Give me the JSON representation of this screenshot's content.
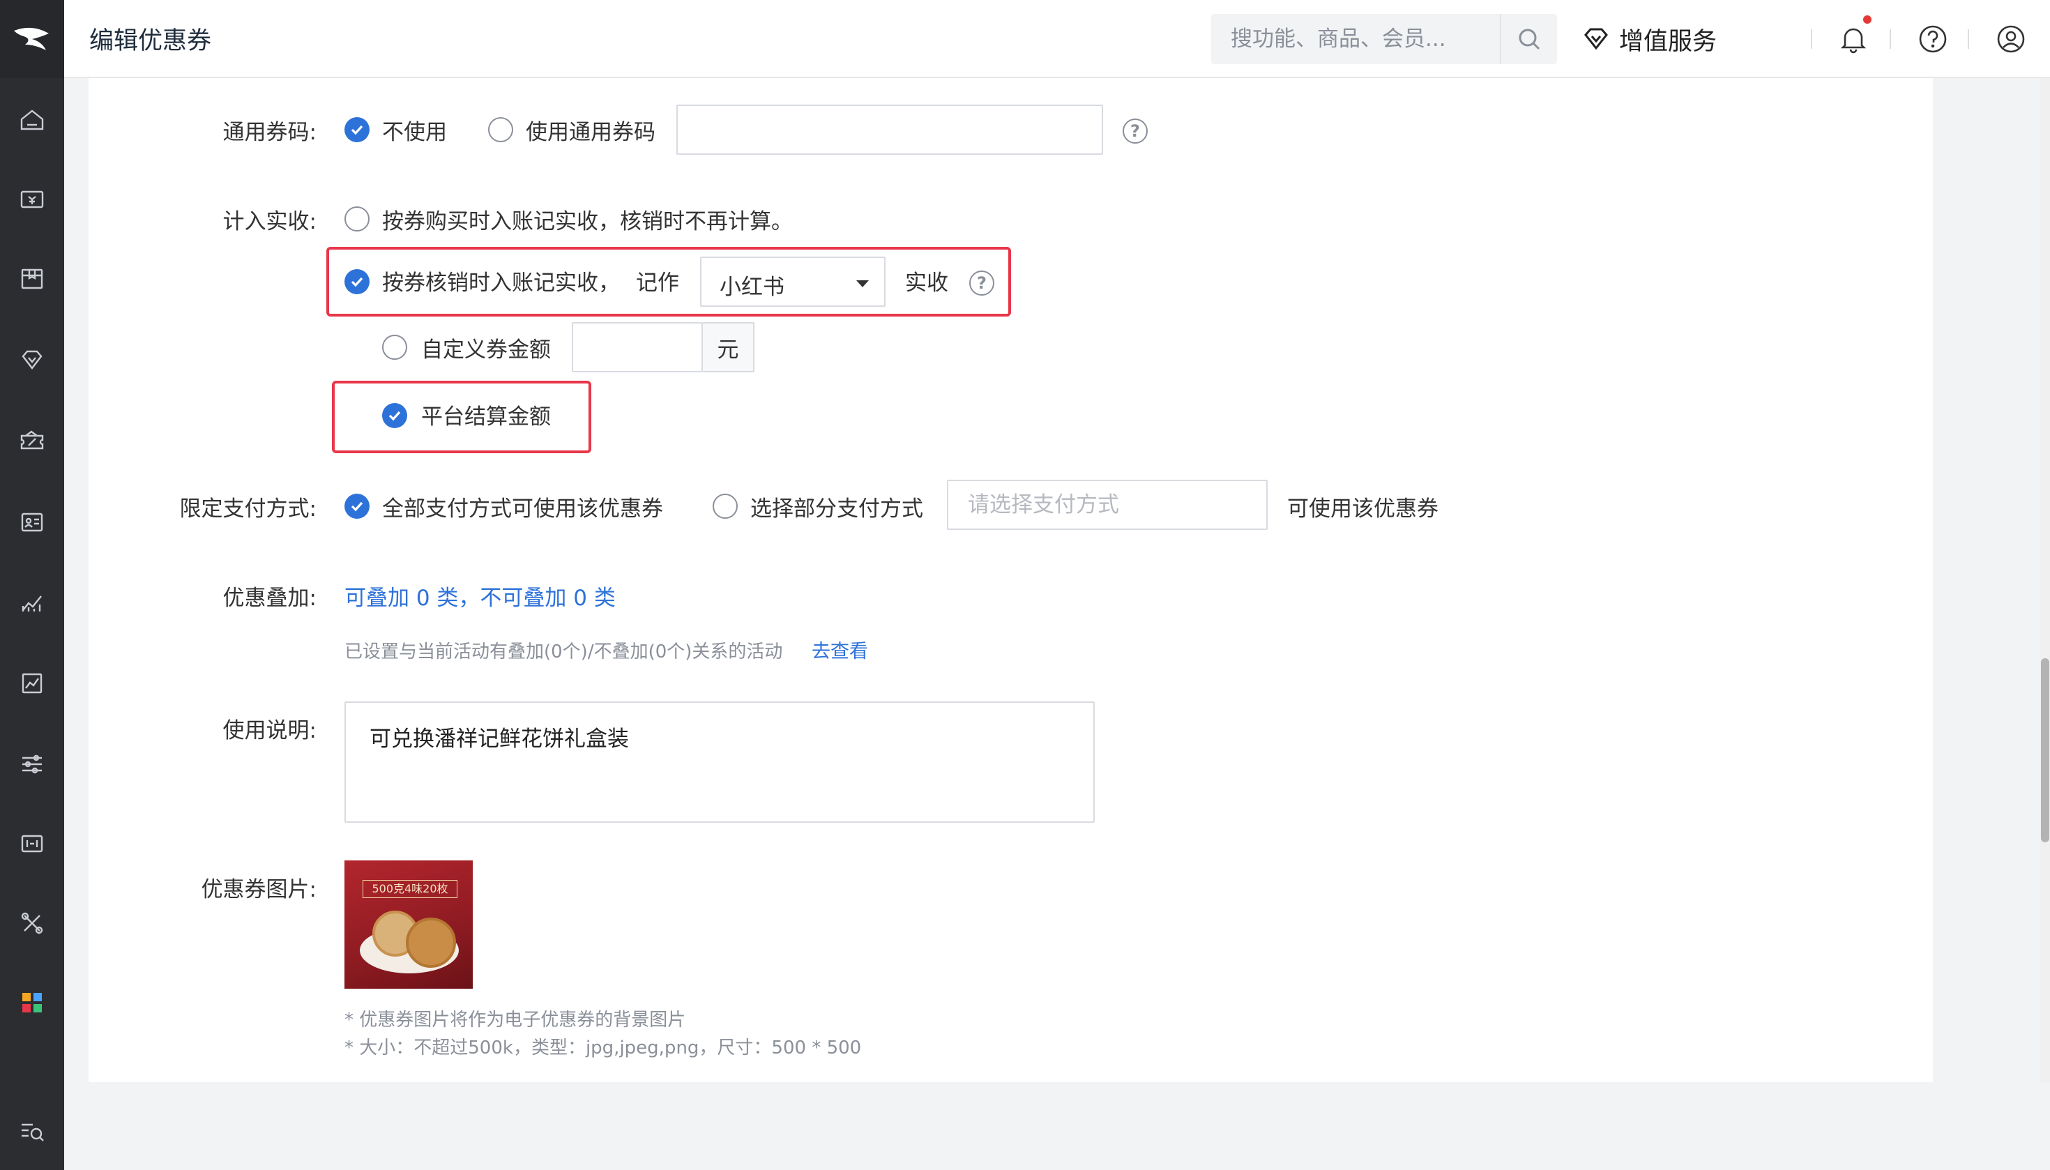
{
  "header": {
    "title": "编辑优惠券",
    "search_placeholder": "搜功能、商品、会员...",
    "value_added_service": "增值服务"
  },
  "form": {
    "general_code": {
      "label": "通用券码:",
      "option_none": "不使用",
      "option_use": "使用通用券码",
      "selected": "不使用"
    },
    "revenue": {
      "label": "计入实收:",
      "option_purchase": "按券购买时入账记实收，核销时不再计算。",
      "option_verify": "按券核销时入账记实收，",
      "record_as": "记作",
      "channel_value": "小红书",
      "suffix": "实收",
      "custom_amount": "自定义券金额",
      "custom_unit": "元",
      "platform_amount": "平台结算金额",
      "selected": "按券核销时入账记实收，",
      "sub_selected": "平台结算金额"
    },
    "payment": {
      "label": "限定支付方式:",
      "option_all": "全部支付方式可使用该优惠券",
      "option_partial": "选择部分支付方式",
      "partial_placeholder": "请选择支付方式",
      "suffix": "可使用该优惠券",
      "selected": "全部支付方式可使用该优惠券"
    },
    "stacking": {
      "label": "优惠叠加:",
      "summary_link": "可叠加 0 类，不可叠加 0 类",
      "hint": "已设置与当前活动有叠加(0个)/不叠加(0个)关系的活动",
      "view_link": "去查看"
    },
    "description": {
      "label": "使用说明:",
      "value": "可兑换潘祥记鲜花饼礼盒装"
    },
    "image": {
      "label": "优惠券图片:",
      "img_text": "500克4味20枚",
      "note1": "* 优惠券图片将作为电子优惠券的背景图片",
      "note2": "* 大小：不超过500k，类型：jpg,jpeg,png，尺寸：500 * 500"
    }
  },
  "colors": {
    "primary": "#2d72d9",
    "highlight": "#e8374a",
    "sidebar": "#2b2d31"
  }
}
